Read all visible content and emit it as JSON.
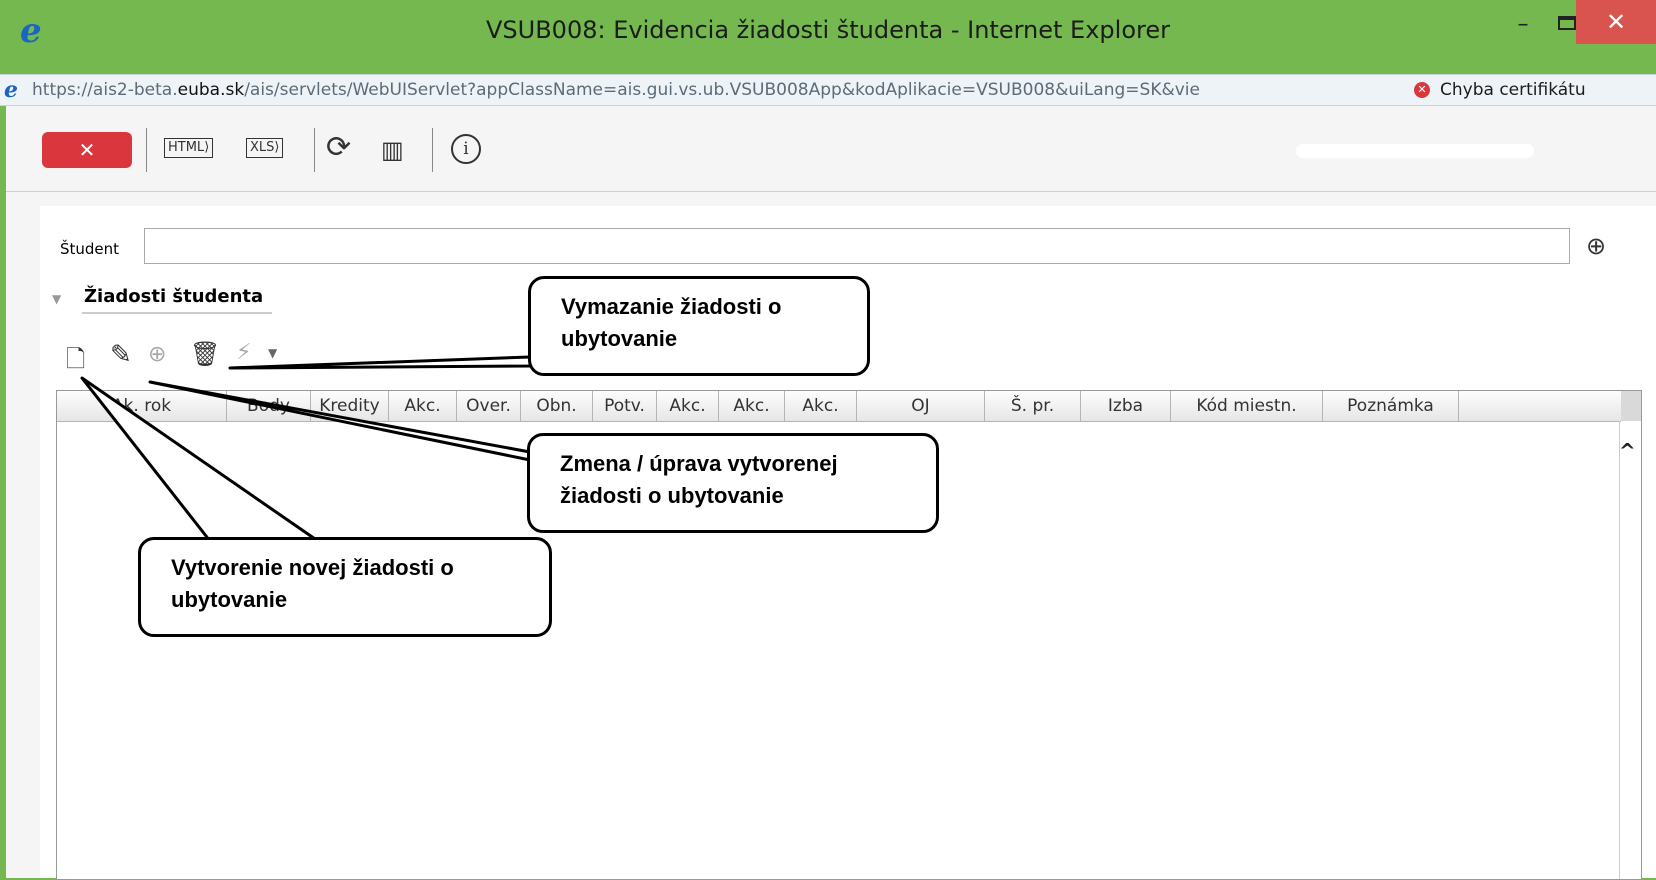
{
  "window": {
    "title": "VSUB008: Evidencia žiadosti študenta - Internet Explorer",
    "minimize": "–",
    "close": "✕"
  },
  "address": {
    "url_prefix": "https://ais2-beta.",
    "url_domain": "euba.sk",
    "url_suffix": "/ais/servlets/WebUIServlet?appClassName=ais.gui.vs.ub.VSUB008App&kodAplikacie=VSUB008&uiLang=SK&vie",
    "cert_error": "Chyba certifikátu"
  },
  "toolbar": {
    "close_label": "✕",
    "html_label": "HTML",
    "xls_label": "XLS",
    "info_label": "i"
  },
  "form": {
    "student_label": "Študent",
    "student_value": ""
  },
  "panel": {
    "title": "Žiadosti študenta"
  },
  "table": {
    "columns": [
      {
        "label": "Ak. rok",
        "w": 0
      },
      {
        "label": "Body"
      },
      {
        "label": "Kredity"
      },
      {
        "label": "Akc."
      },
      {
        "label": "Over."
      },
      {
        "label": "Obn."
      },
      {
        "label": "Potv."
      },
      {
        "label": "Akc."
      },
      {
        "label": "Akc."
      },
      {
        "label": "Akc."
      },
      {
        "label": "OJ"
      },
      {
        "label": "Š. pr."
      },
      {
        "label": "Izba"
      },
      {
        "label": "Kód miestn."
      },
      {
        "label": "Poznámka"
      }
    ]
  },
  "callouts": {
    "delete": [
      "Vymazanie žiadosti o",
      "ubytovanie"
    ],
    "edit": [
      "Zmena / úprava vytvorenej",
      "žiadosti o ubytovanie"
    ],
    "new": [
      "Vytvorenie novej žiadosti o",
      "ubytovanie"
    ]
  }
}
